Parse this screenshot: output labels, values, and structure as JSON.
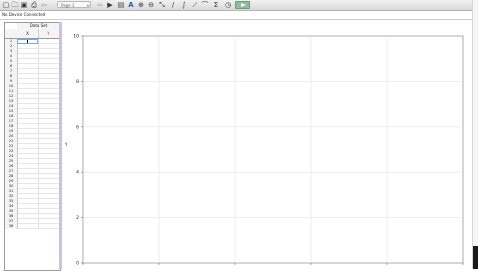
{
  "toolbar": {
    "page_label": "Page 1",
    "icons": [
      "new-file-icon",
      "open-folder-icon",
      "save-icon",
      "print-icon",
      "undo-icon",
      "redo-icon",
      "calculator-icon",
      "text-annotation-icon",
      "zoom-in-icon",
      "zoom-out-icon",
      "curve-fit-icon",
      "tangent-icon",
      "integral-icon",
      "linear-fit-icon",
      "curve-draw-icon",
      "stats-icon",
      "timer-icon",
      "collect-button"
    ]
  },
  "status": {
    "text": "No Device Connected"
  },
  "table": {
    "title": "Data Set",
    "columns": [
      {
        "label": "X",
        "color": "#222222"
      },
      {
        "label": "Y",
        "color": "#dd3333"
      }
    ],
    "row_numbers": [
      "1",
      "2",
      "3",
      "4",
      "5",
      "6",
      "7",
      "8",
      "9",
      "10",
      "11",
      "12",
      "13",
      "14",
      "15",
      "16",
      "17",
      "18",
      "19",
      "20",
      "21",
      "22",
      "23",
      "24",
      "25",
      "26",
      "27",
      "28",
      "29",
      "30",
      "31",
      "32",
      "33",
      "34",
      "35",
      "36",
      "37",
      "38"
    ],
    "active_row": 1
  },
  "graph": {
    "ylabel": "Y",
    "y_ticks": [
      "0",
      "2",
      "4",
      "6",
      "8",
      "10"
    ],
    "ylim": [
      0,
      10
    ],
    "grid": true
  }
}
